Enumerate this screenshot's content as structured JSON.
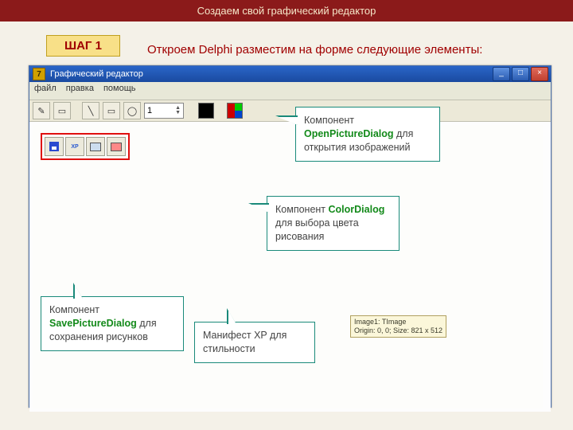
{
  "slide": {
    "title": "Создаем свой графический редактор",
    "step_badge": "ШАГ 1",
    "instruction": "Откроем Delphi разместим на форме следующие элементы:"
  },
  "app": {
    "window_title": "Графический редактор",
    "app_icon_char": "7",
    "menus": [
      "файл",
      "правка",
      "помощь"
    ],
    "win_buttons": {
      "minimize": "_",
      "maximize": "□",
      "close": "×"
    },
    "toolbar": {
      "spin_value": "1",
      "icons": {
        "pencil": "✎",
        "eraser": "▭",
        "line": "╲",
        "rect": "▭",
        "ellipse": "◯"
      }
    },
    "comp_palette": {
      "xp_label": "XP"
    },
    "tooltip": {
      "line1": "Image1: TImage",
      "line2": "Origin: 0, 0; Size: 821 x 512"
    }
  },
  "callouts": {
    "open": {
      "prefix": "Компонент ",
      "keyword": "OpenPictureDialog",
      "suffix": " для открытия изображений"
    },
    "color": {
      "prefix": "Компонент ",
      "keyword": "ColorDialog",
      "suffix": " для выбора цвета рисования"
    },
    "save": {
      "prefix": "Компонент ",
      "keyword": "SavePictureDialog",
      "suffix": " для сохранения рисунков"
    },
    "manifest": {
      "text": "Манифест XP для стильности"
    }
  }
}
